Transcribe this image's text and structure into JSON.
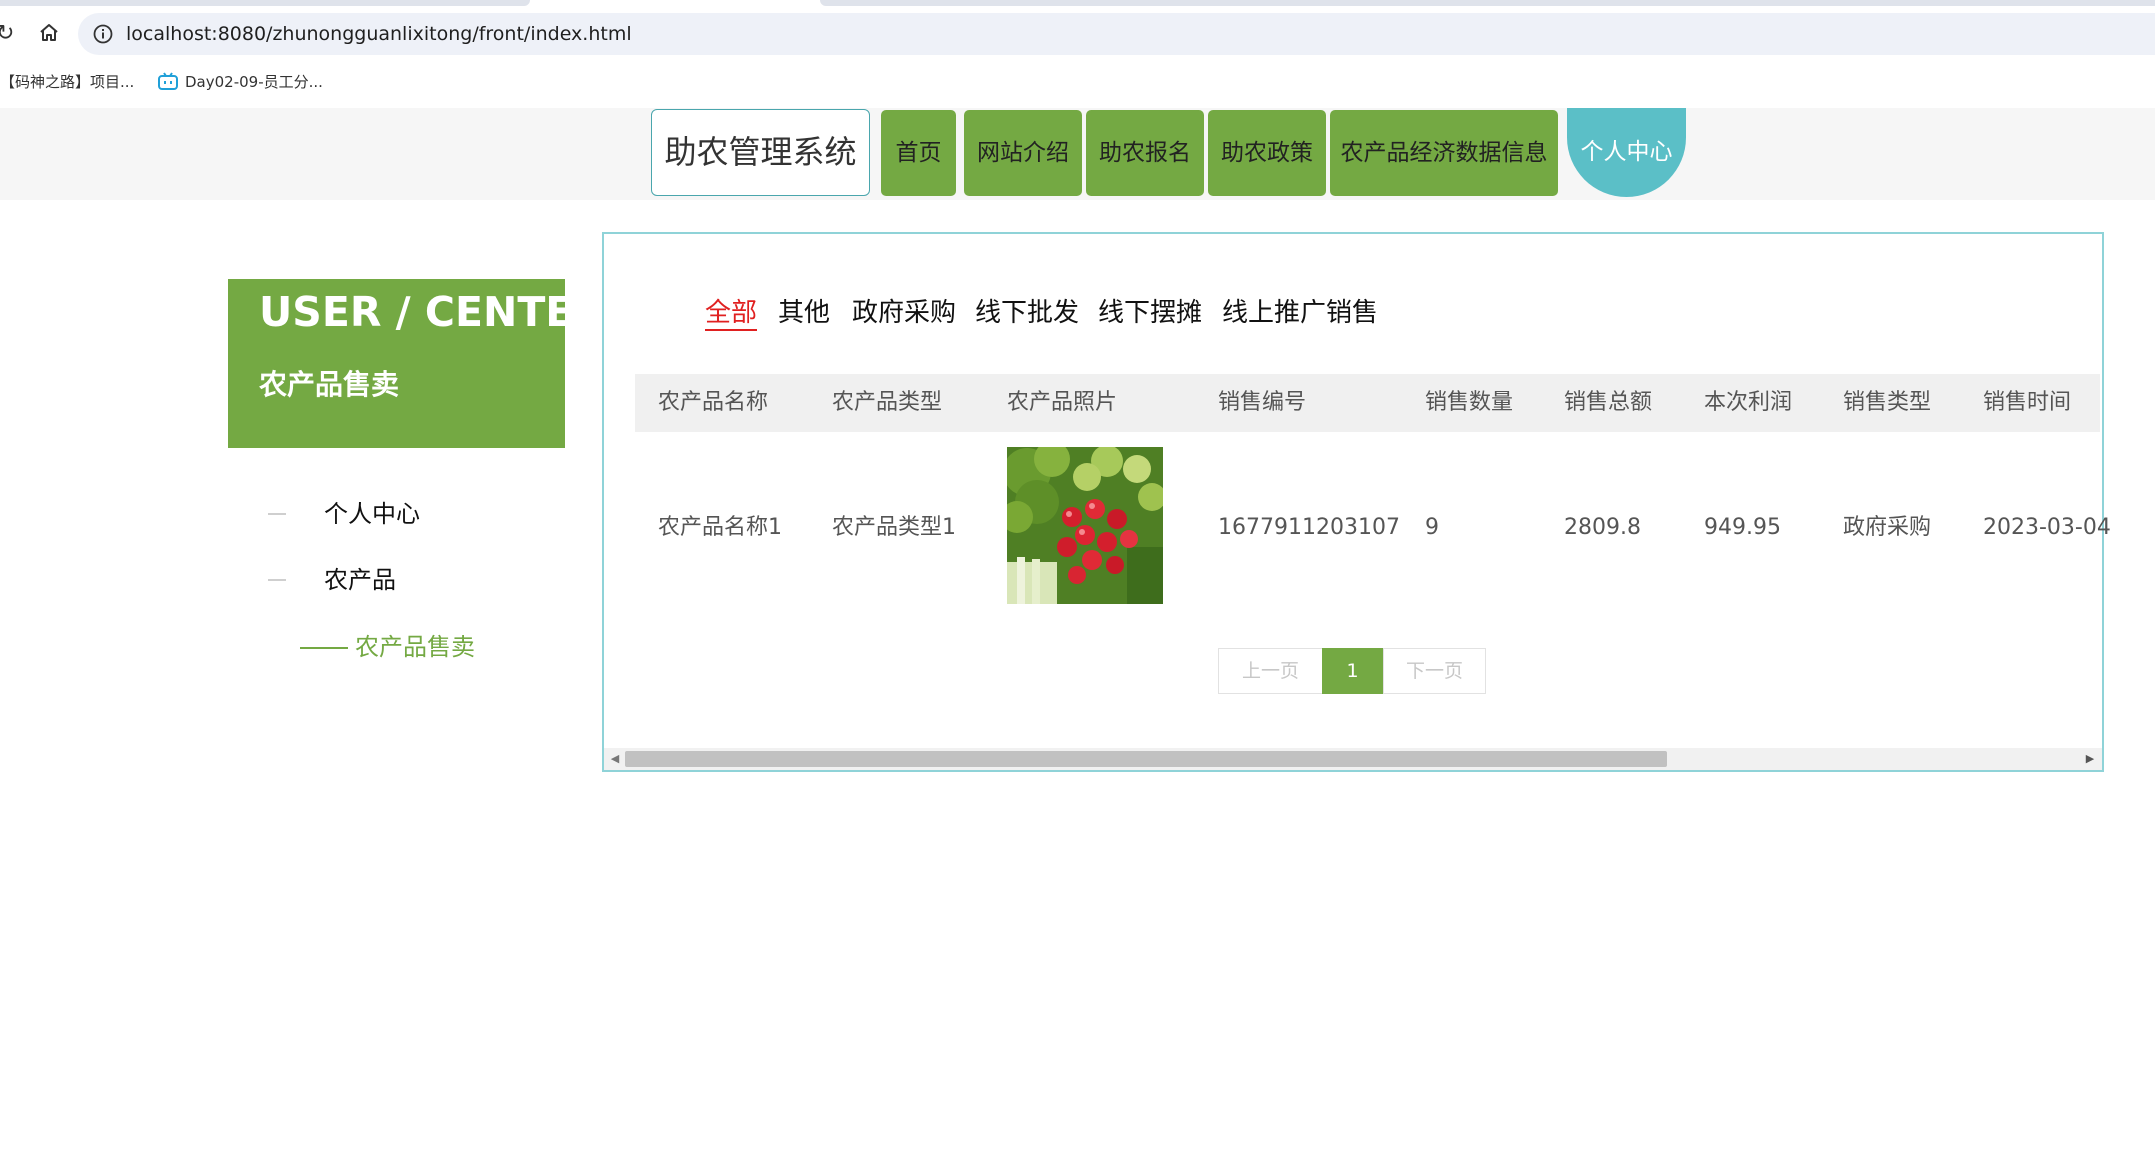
{
  "browser": {
    "url": "localhost:8080/zhunongguanlixitong/front/index.html",
    "bookmarks": [
      "【码神之路】项目...",
      "Day02-09-员工分..."
    ]
  },
  "site": {
    "logo": "助农管理系统",
    "nav": [
      "首页",
      "网站介绍",
      "助农报名",
      "助农政策",
      "农产品经济数据信息",
      "个人中心"
    ],
    "active_nav": "个人中心",
    "accent_color": "#74a943",
    "active_color": "#5bbfc7"
  },
  "sidebar": {
    "title": "USER / CENTER",
    "subtitle": "农产品售卖",
    "items": [
      "个人中心",
      "农产品"
    ],
    "active_sub_item": "农产品售卖"
  },
  "filters": {
    "tabs": [
      "全部",
      "其他",
      "政府采购",
      "线下批发",
      "线下摆摊",
      "线上推广销售"
    ],
    "active": "全部"
  },
  "table": {
    "columns": [
      "农产品名称",
      "农产品类型",
      "农产品照片",
      "销售编号",
      "销售数量",
      "销售总额",
      "本次利润",
      "销售类型",
      "销售时间"
    ],
    "rows": [
      {
        "name": "农产品名称1",
        "type": "农产品类型1",
        "sale_no": "1677911203107",
        "quantity": "9",
        "total": "2809.8",
        "profit": "949.95",
        "sale_type": "政府采购",
        "time": "2023-03-04"
      }
    ]
  },
  "pager": {
    "prev": "上一页",
    "current": "1",
    "next": "下一页"
  }
}
